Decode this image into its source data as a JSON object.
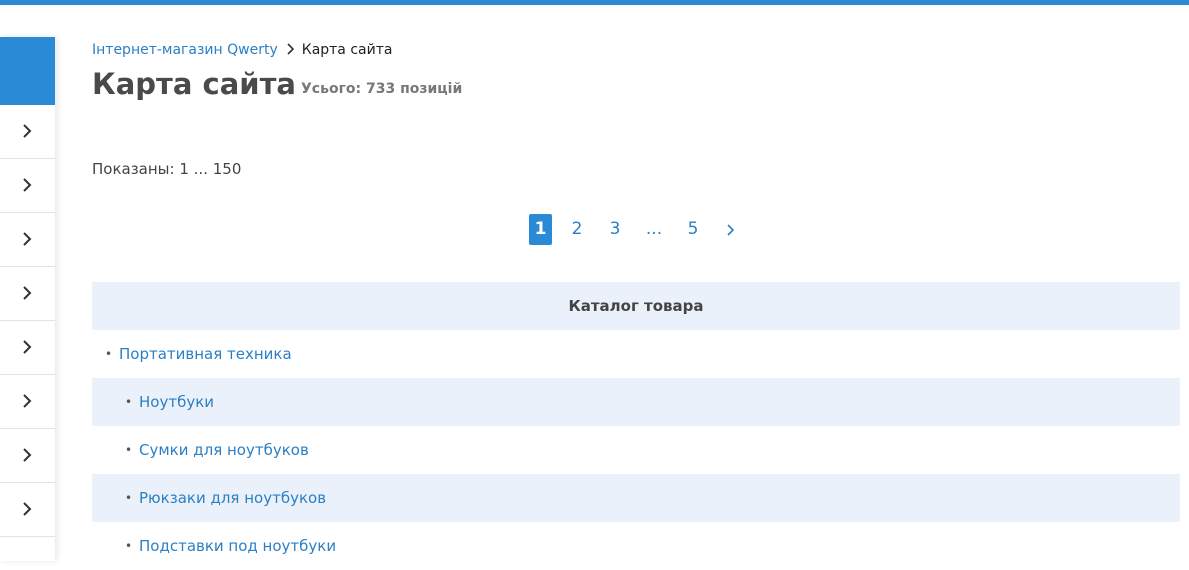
{
  "colors": {
    "accent": "#2b8ad6",
    "link": "#2b7fc5",
    "row_alt": "#eaf1fa"
  },
  "sidebar": {
    "items": [
      {
        "icon": "chevron-right-icon"
      },
      {
        "icon": "chevron-right-icon"
      },
      {
        "icon": "chevron-right-icon"
      },
      {
        "icon": "chevron-right-icon"
      },
      {
        "icon": "chevron-right-icon"
      },
      {
        "icon": "chevron-right-icon"
      },
      {
        "icon": "chevron-right-icon"
      },
      {
        "icon": "chevron-right-icon"
      }
    ]
  },
  "breadcrumb": {
    "home": "Інтернет-магазин Qwerty",
    "current": "Карта сайта"
  },
  "page": {
    "title": "Карта сайта",
    "total": "Усього: 733 позицій",
    "shown": "Показаны: 1 ... 150"
  },
  "pagination": {
    "pages": [
      "1",
      "2",
      "3",
      "...",
      "5"
    ],
    "active": "1",
    "next_icon": "chevron-right-icon"
  },
  "catalog": {
    "header": "Каталог товара",
    "rows": [
      {
        "label": "Портативная техника",
        "level": 0
      },
      {
        "label": "Ноутбуки",
        "level": 1
      },
      {
        "label": "Сумки для ноутбуков",
        "level": 1
      },
      {
        "label": "Рюкзаки для ноутбуков",
        "level": 1
      },
      {
        "label": "Подставки под ноутбуки",
        "level": 1
      }
    ],
    "bullet": "•"
  }
}
